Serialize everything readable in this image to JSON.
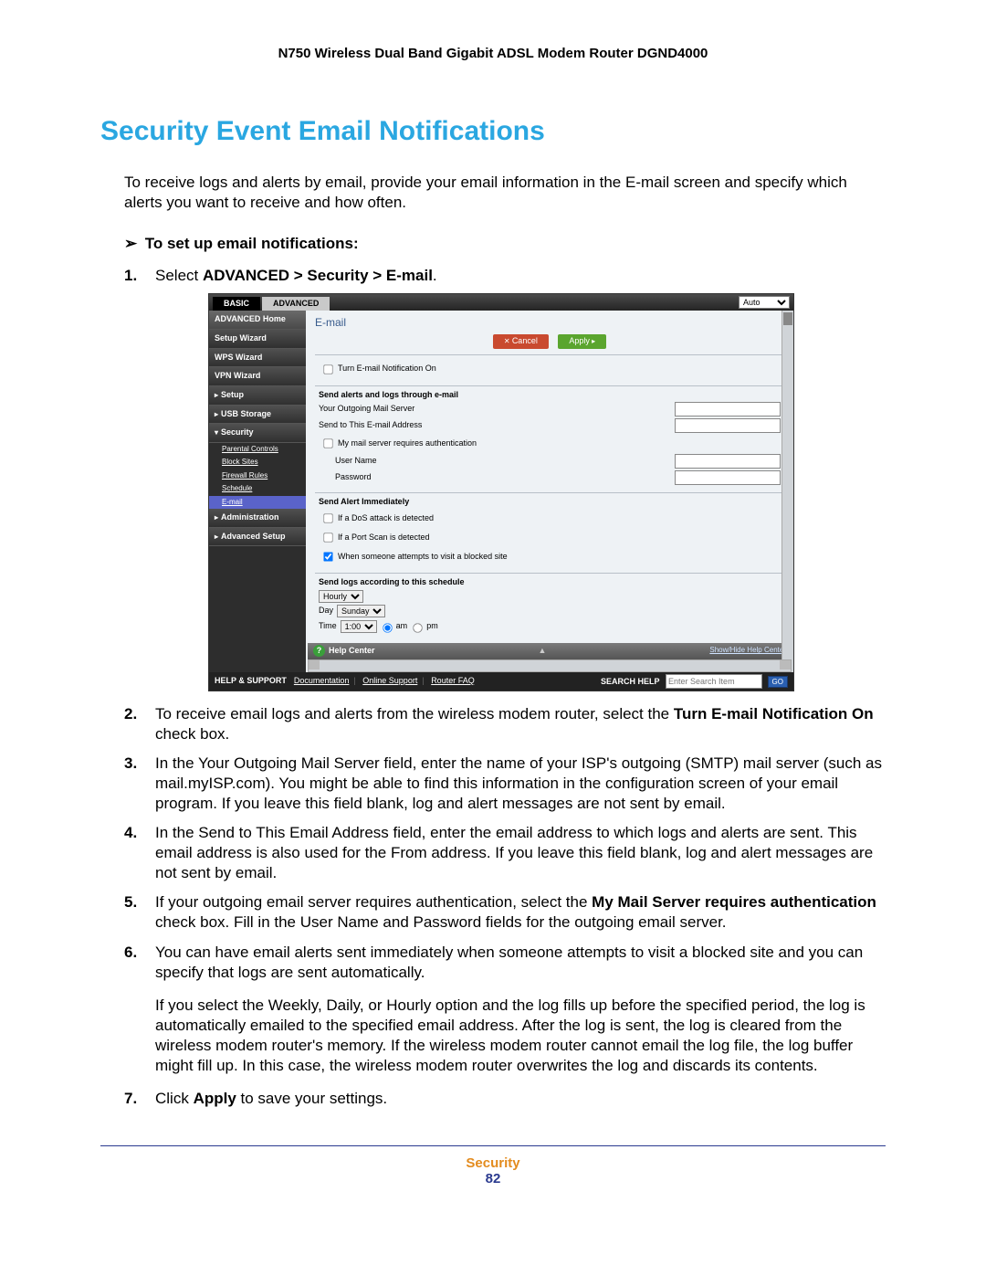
{
  "doc": {
    "header": "N750 Wireless Dual Band Gigabit ADSL Modem Router DGND4000",
    "section_title": "Security Event Email Notifications",
    "intro": "To receive logs and alerts by email, provide your email information in the E-mail screen and specify which alerts you want to receive and how often.",
    "task_heading": "To set up email notifications:",
    "footer_category": "Security",
    "footer_page": "82"
  },
  "steps": {
    "s1_pre": "Select ",
    "s1_bold": "ADVANCED > Security > E-mail",
    "s1_post": ".",
    "s2_pre": "To receive email logs and alerts from the wireless modem router, select the ",
    "s2_bold": "Turn E-mail Notification On",
    "s2_post": " check box.",
    "s3": "In the Your Outgoing Mail Server field, enter the name of your ISP's outgoing (SMTP) mail server (such as mail.myISP.com). You might be able to find this information in the configuration screen of your email program. If you leave this field blank, log and alert messages are not sent by email.",
    "s4": "In the Send to This Email Address field, enter the email address to which logs and alerts are sent. This email address is also used for the From address. If you leave this field blank, log and alert messages are not sent by email.",
    "s5_pre": "If your outgoing email server requires authentication, select the ",
    "s5_bold": "My Mail Server requires authentication",
    "s5_post": " check box. Fill in the User Name and Password fields for the outgoing email server.",
    "s6": "You can have email alerts sent immediately when someone attempts to visit a blocked site and you can specify that logs are sent automatically.",
    "s6_extra": "If you select the Weekly, Daily, or Hourly option and the log fills up before the specified period, the log is automatically emailed to the specified email address. After the log is sent, the log is cleared from the wireless modem router's memory. If the wireless modem router cannot email the log file, the log buffer might fill up. In this case, the wireless modem router overwrites the log and discards its contents.",
    "s7_pre": "Click ",
    "s7_bold": "Apply",
    "s7_post": " to save your settings."
  },
  "fig": {
    "tabs": {
      "basic": "BASIC",
      "advanced": "ADVANCED",
      "auto": "Auto"
    },
    "sidebar": {
      "home": "ADVANCED Home",
      "setup_wiz": "Setup Wizard",
      "wps_wiz": "WPS Wizard",
      "vpn_wiz": "VPN Wizard",
      "setup": "Setup",
      "usb": "USB Storage",
      "security": "Security",
      "sec_parental": "Parental Controls",
      "sec_block": "Block Sites",
      "sec_firewall": "Firewall Rules",
      "sec_schedule": "Schedule",
      "sec_email": "E-mail",
      "admin": "Administration",
      "adv_setup": "Advanced Setup"
    },
    "content": {
      "title": "E-mail",
      "btn_cancel": "Cancel",
      "btn_apply": "Apply",
      "turn_on": "Turn E-mail Notification On",
      "send_hdr": "Send alerts and logs through e-mail",
      "smtp": "Your Outgoing Mail Server",
      "sendto": "Send to This E-mail Address",
      "auth": "My mail server requires authentication",
      "user": "User Name",
      "pass": "Password",
      "alert_hdr": "Send Alert Immediately",
      "alert_dos": "If a DoS attack is detected",
      "alert_port": "If a Port Scan is detected",
      "alert_block": "When someone attempts to visit a blocked site",
      "sched_hdr": "Send logs according to this schedule",
      "sched_sel": "Hourly",
      "day_lbl": "Day",
      "day_sel": "Sunday",
      "time_lbl": "Time",
      "time_sel": "1:00",
      "am": "am",
      "pm": "pm",
      "help_center": "Help Center",
      "help_toggle": "Show/Hide Help Center"
    },
    "support": {
      "label": "HELP & SUPPORT",
      "doc": "Documentation",
      "online": "Online Support",
      "faq": "Router FAQ",
      "search_lbl": "SEARCH HELP",
      "search_ph": "Enter Search Item",
      "go": "GO"
    }
  }
}
